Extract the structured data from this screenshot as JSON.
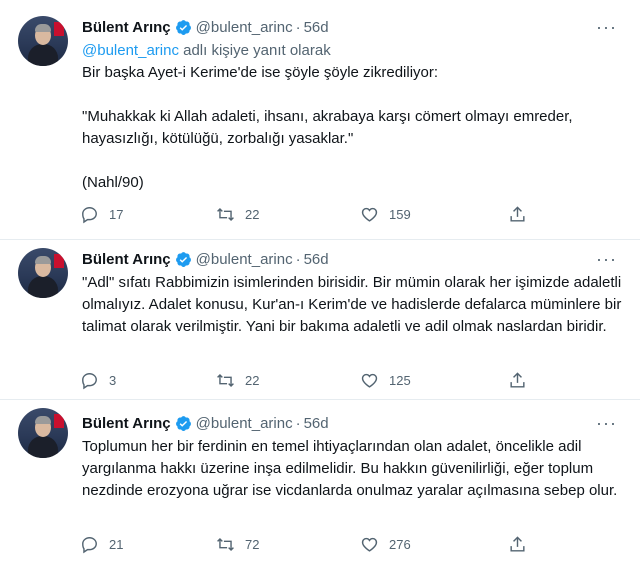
{
  "tweets": [
    {
      "name": "Bülent Arınç",
      "handle": "@bulent_arinc",
      "separator": "·",
      "time": "56d",
      "reply_prefix_link": "@bulent_arinc",
      "reply_suffix": " adlı kişiye yanıt olarak",
      "text_lines": [
        "Bir başka Ayet-i Kerime'de ise şöyle şöyle zikrediliyor:",
        "",
        "\"Muhakkak ki Allah adaleti, ihsanı, akrabaya karşı cömert olmayı emreder, hayasızlığı, kötülüğü, zorbalığı yasaklar.\"",
        "",
        "(Nahl/90)"
      ],
      "replies": "17",
      "retweets": "22",
      "likes": "159"
    },
    {
      "name": "Bülent Arınç",
      "handle": "@bulent_arinc",
      "separator": "·",
      "time": "56d",
      "text_lines": [
        "\"Adl\" sıfatı Rabbimizin isimlerinden birisidir. Bir mümin olarak her işimizde adaletli olmalıyız. Adalet konusu, Kur'an-ı Kerim'de ve hadislerde defalarca müminlere bir talimat olarak verilmiştir. Yani bir bakıma adaletli ve adil olmak naslardan biridir."
      ],
      "replies": "3",
      "retweets": "22",
      "likes": "125"
    },
    {
      "name": "Bülent Arınç",
      "handle": "@bulent_arinc",
      "separator": "·",
      "time": "56d",
      "text_lines": [
        "Toplumun her bir ferdinin en temel ihtiyaçlarından olan adalet, öncelikle adil yargılanma hakkı üzerine inşa edilmelidir. Bu hakkın güvenilirliği, eğer toplum nezdinde erozyona uğrar ise vicdanlarda onulmaz yaralar açılmasına sebep olur."
      ],
      "replies": "21",
      "retweets": "72",
      "likes": "276"
    }
  ],
  "icons": {
    "more": "more-horizontal-icon",
    "reply": "reply-bubble-icon",
    "retweet": "retweet-icon",
    "like": "heart-icon",
    "share": "share-icon",
    "verified": "verified-badge-icon"
  },
  "colors": {
    "text": "#0f1419",
    "secondary": "#536471",
    "link": "#1d9bf0",
    "verified": "#1d9bf0",
    "divider": "#e6ecf0"
  }
}
